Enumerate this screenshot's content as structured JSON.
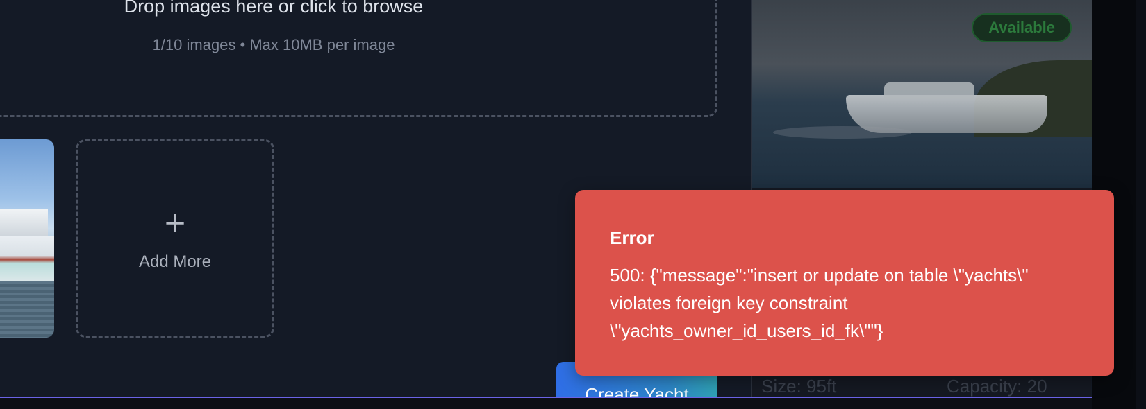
{
  "upload": {
    "title": "Drop images here or click to browse",
    "subtitle": "1/10 images • Max 10MB per image",
    "add_more_label": "Add More",
    "add_more_icon": "plus-icon",
    "upload_icon": "upload-icon"
  },
  "actions": {
    "create_label": "Create Yacht"
  },
  "preview": {
    "status": "Available",
    "size": "Size: 95ft",
    "capacity": "Capacity: 20"
  },
  "toast": {
    "title": "Error",
    "message": "500: {\"message\":\"insert or update on table \\\"yachts\\\" violates foreign key constraint \\\"yachts_owner_id_users_id_fk\\\"\"}"
  },
  "colors": {
    "accent_border": "#6b63e6",
    "error": "#dc524b",
    "primary_button": "#2f6ee6",
    "success": "#2c7a3c"
  }
}
